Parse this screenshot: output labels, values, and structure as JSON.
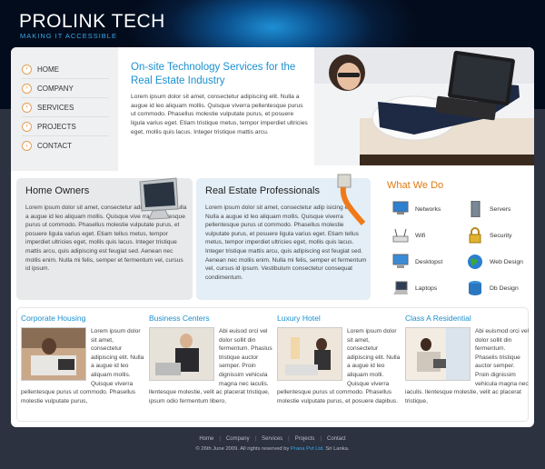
{
  "header": {
    "logo": "PROLINK TECH",
    "tagline": "MAKING IT ACCESSIBLE"
  },
  "nav": [
    {
      "label": "HOME",
      "icon": "home-icon"
    },
    {
      "label": "COMPANY",
      "icon": "company-icon"
    },
    {
      "label": "SERVICES",
      "icon": "services-icon"
    },
    {
      "label": "PROJECTS",
      "icon": "projects-icon"
    },
    {
      "label": "CONTACT",
      "icon": "contact-icon"
    }
  ],
  "intro": {
    "title": "On-site Technology Services for the Real Estate Industry",
    "text": "Lorem ipsum dolor sit amet, consectetur adipiscing elit. Nulla a augue id leo aliquam mollis. Quisque viverra pellentesque purus ut commodo. Phasellus molestie vulputate purus, et posuere ligula varius eget. Etiam tristique metus, tempor imperdiet ultricies eget, mollis quis lacus. Integer tristique mattis arcu."
  },
  "home_owners": {
    "title": "Home Owners",
    "text": "Lorem ipsum dolor sit amet, consectetur adipiscing elit. Nulla a augue id leo aliquam mollis. Quisque vive rra pellentesque purus ut commodo. Phasellus molestie vulputate purus, et posuere ligula varius eget. Etiam tellus metus, tempor imperdiet ultricies eget, mollis quis lacus. Integer tristique mattis arcu, quis adipiscing est feugiat sed. Aenean nec mollis enim. Nulla mi felis, semper et fermentum vel, cursus id ipsum."
  },
  "real_estate": {
    "title": "Real Estate Professionals",
    "text": "Lorem ipsum dolor sit amet, consectetur adip isicing elit. Nulla a augue id leo aliquam mollis. Quisque viverra pellentesque purus ut commodo. Phasellus molestie vulputate purus, et posuere ligula varius eget. Etiam tellus metus, tempor imperdiet ultricies eget, mollis quis lacus. Integer tristique mattis arcu, quis adipiscing est feugiat sed. Aenean nec mollis enim. Nulla mi felis, semper et fermentum vel, cursus id ipsum. Vestibulum consectetur consequat condimentum."
  },
  "what_we_do": {
    "title": "What We Do",
    "items": [
      {
        "label": "Networks",
        "icon": "networks-icon"
      },
      {
        "label": "Servers",
        "icon": "servers-icon"
      },
      {
        "label": "Wifi",
        "icon": "wifi-icon"
      },
      {
        "label": "Security",
        "icon": "security-icon"
      },
      {
        "label": "Desktopst",
        "icon": "desktop-icon"
      },
      {
        "label": "Web Design",
        "icon": "web-design-icon"
      },
      {
        "label": "Laptops",
        "icon": "laptops-icon"
      },
      {
        "label": "Db Design",
        "icon": "db-design-icon"
      }
    ]
  },
  "columns": [
    {
      "title": "Corporate Housing",
      "text": "Lorem ipsum dolor sit amet, consectetur adipiscing elit. Nulla a augue id leo aliquam mollis. Quisque viverra pellentesque purus ut commodo. Phasellus molestie vulputate purus,"
    },
    {
      "title": "Business Centers",
      "text": "Abi euisod orci vel dolor sollit din fermentum. Phaslus tristique auctor semper. Proin dignissim vehicula magna nec iaculis. llentesque molestie, velit ac placerat tristique, ipsum odio fermentum libero,"
    },
    {
      "title": "Luxury Hotel",
      "text": "Lorem ipsum dolor sit amet, consectetur adipiscing elit. Nulla a augue id leo aliquam molli. Quisque viverra pellentesque purus ut commodo. Phasellus molestie vulputate purus, et posuere dapibus."
    },
    {
      "title": "Class A Residential",
      "text": "Abi euismod orci vel dolor sollit din fermentum. Phaselis tristique auctor semper. Proin dignissim vehicula magna nec iaculis. llentesque molestie, velit ac placerat tristique,"
    }
  ],
  "footer": {
    "links": [
      "Home",
      "Company",
      "Services",
      "Projects",
      "Contact"
    ],
    "copy_prefix": "© 26th June 2009. All rights reserved by",
    "copy_brand": "Prana Pvt Ltd.",
    "copy_suffix": "Sri Lanka."
  },
  "colors": {
    "accent_blue": "#1a8fd0",
    "accent_orange": "#e07a10",
    "footer_bg": "#2c3240"
  }
}
